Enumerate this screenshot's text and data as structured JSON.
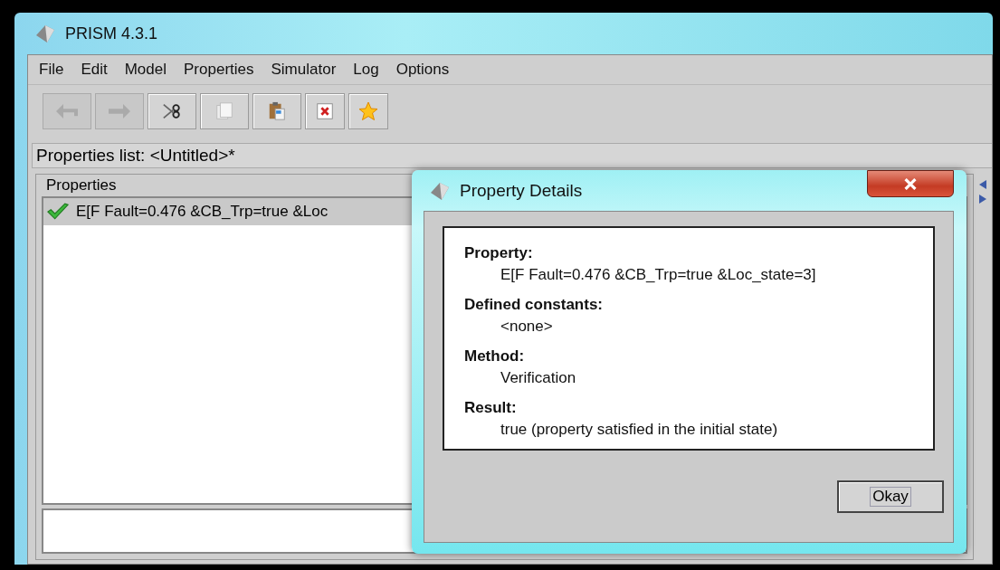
{
  "window": {
    "title": "PRISM 4.3.1"
  },
  "menu": [
    {
      "label": "File"
    },
    {
      "label": "Edit"
    },
    {
      "label": "Model"
    },
    {
      "label": "Properties"
    },
    {
      "label": "Simulator"
    },
    {
      "label": "Log"
    },
    {
      "label": "Options"
    }
  ],
  "toolbar": [
    {
      "kind": "undo",
      "disabled": true
    },
    {
      "kind": "redo",
      "disabled": true
    },
    {
      "kind": "cut",
      "disabled": false
    },
    {
      "kind": "copy",
      "disabled": false
    },
    {
      "kind": "paste",
      "disabled": false
    },
    {
      "kind": "delete",
      "disabled": false
    },
    {
      "kind": "star",
      "disabled": false
    }
  ],
  "properties_list": {
    "title": "Properties list: <Untitled>*",
    "group_label": "Properties",
    "items": [
      {
        "text": "E[F Fault=0.476 &CB_Trp=true &Loc",
        "verified": true,
        "selected": true
      }
    ]
  },
  "dialog": {
    "title": "Property Details",
    "sections": [
      {
        "label": "Property:",
        "value": "E[F Fault=0.476 &CB_Trp=true &Loc_state=3]"
      },
      {
        "label": "Defined constants:",
        "value": "<none>"
      },
      {
        "label": "Method:",
        "value": "Verification"
      },
      {
        "label": "Result:",
        "value": "true (property satisfied in the initial state)"
      }
    ],
    "button": "Okay"
  }
}
